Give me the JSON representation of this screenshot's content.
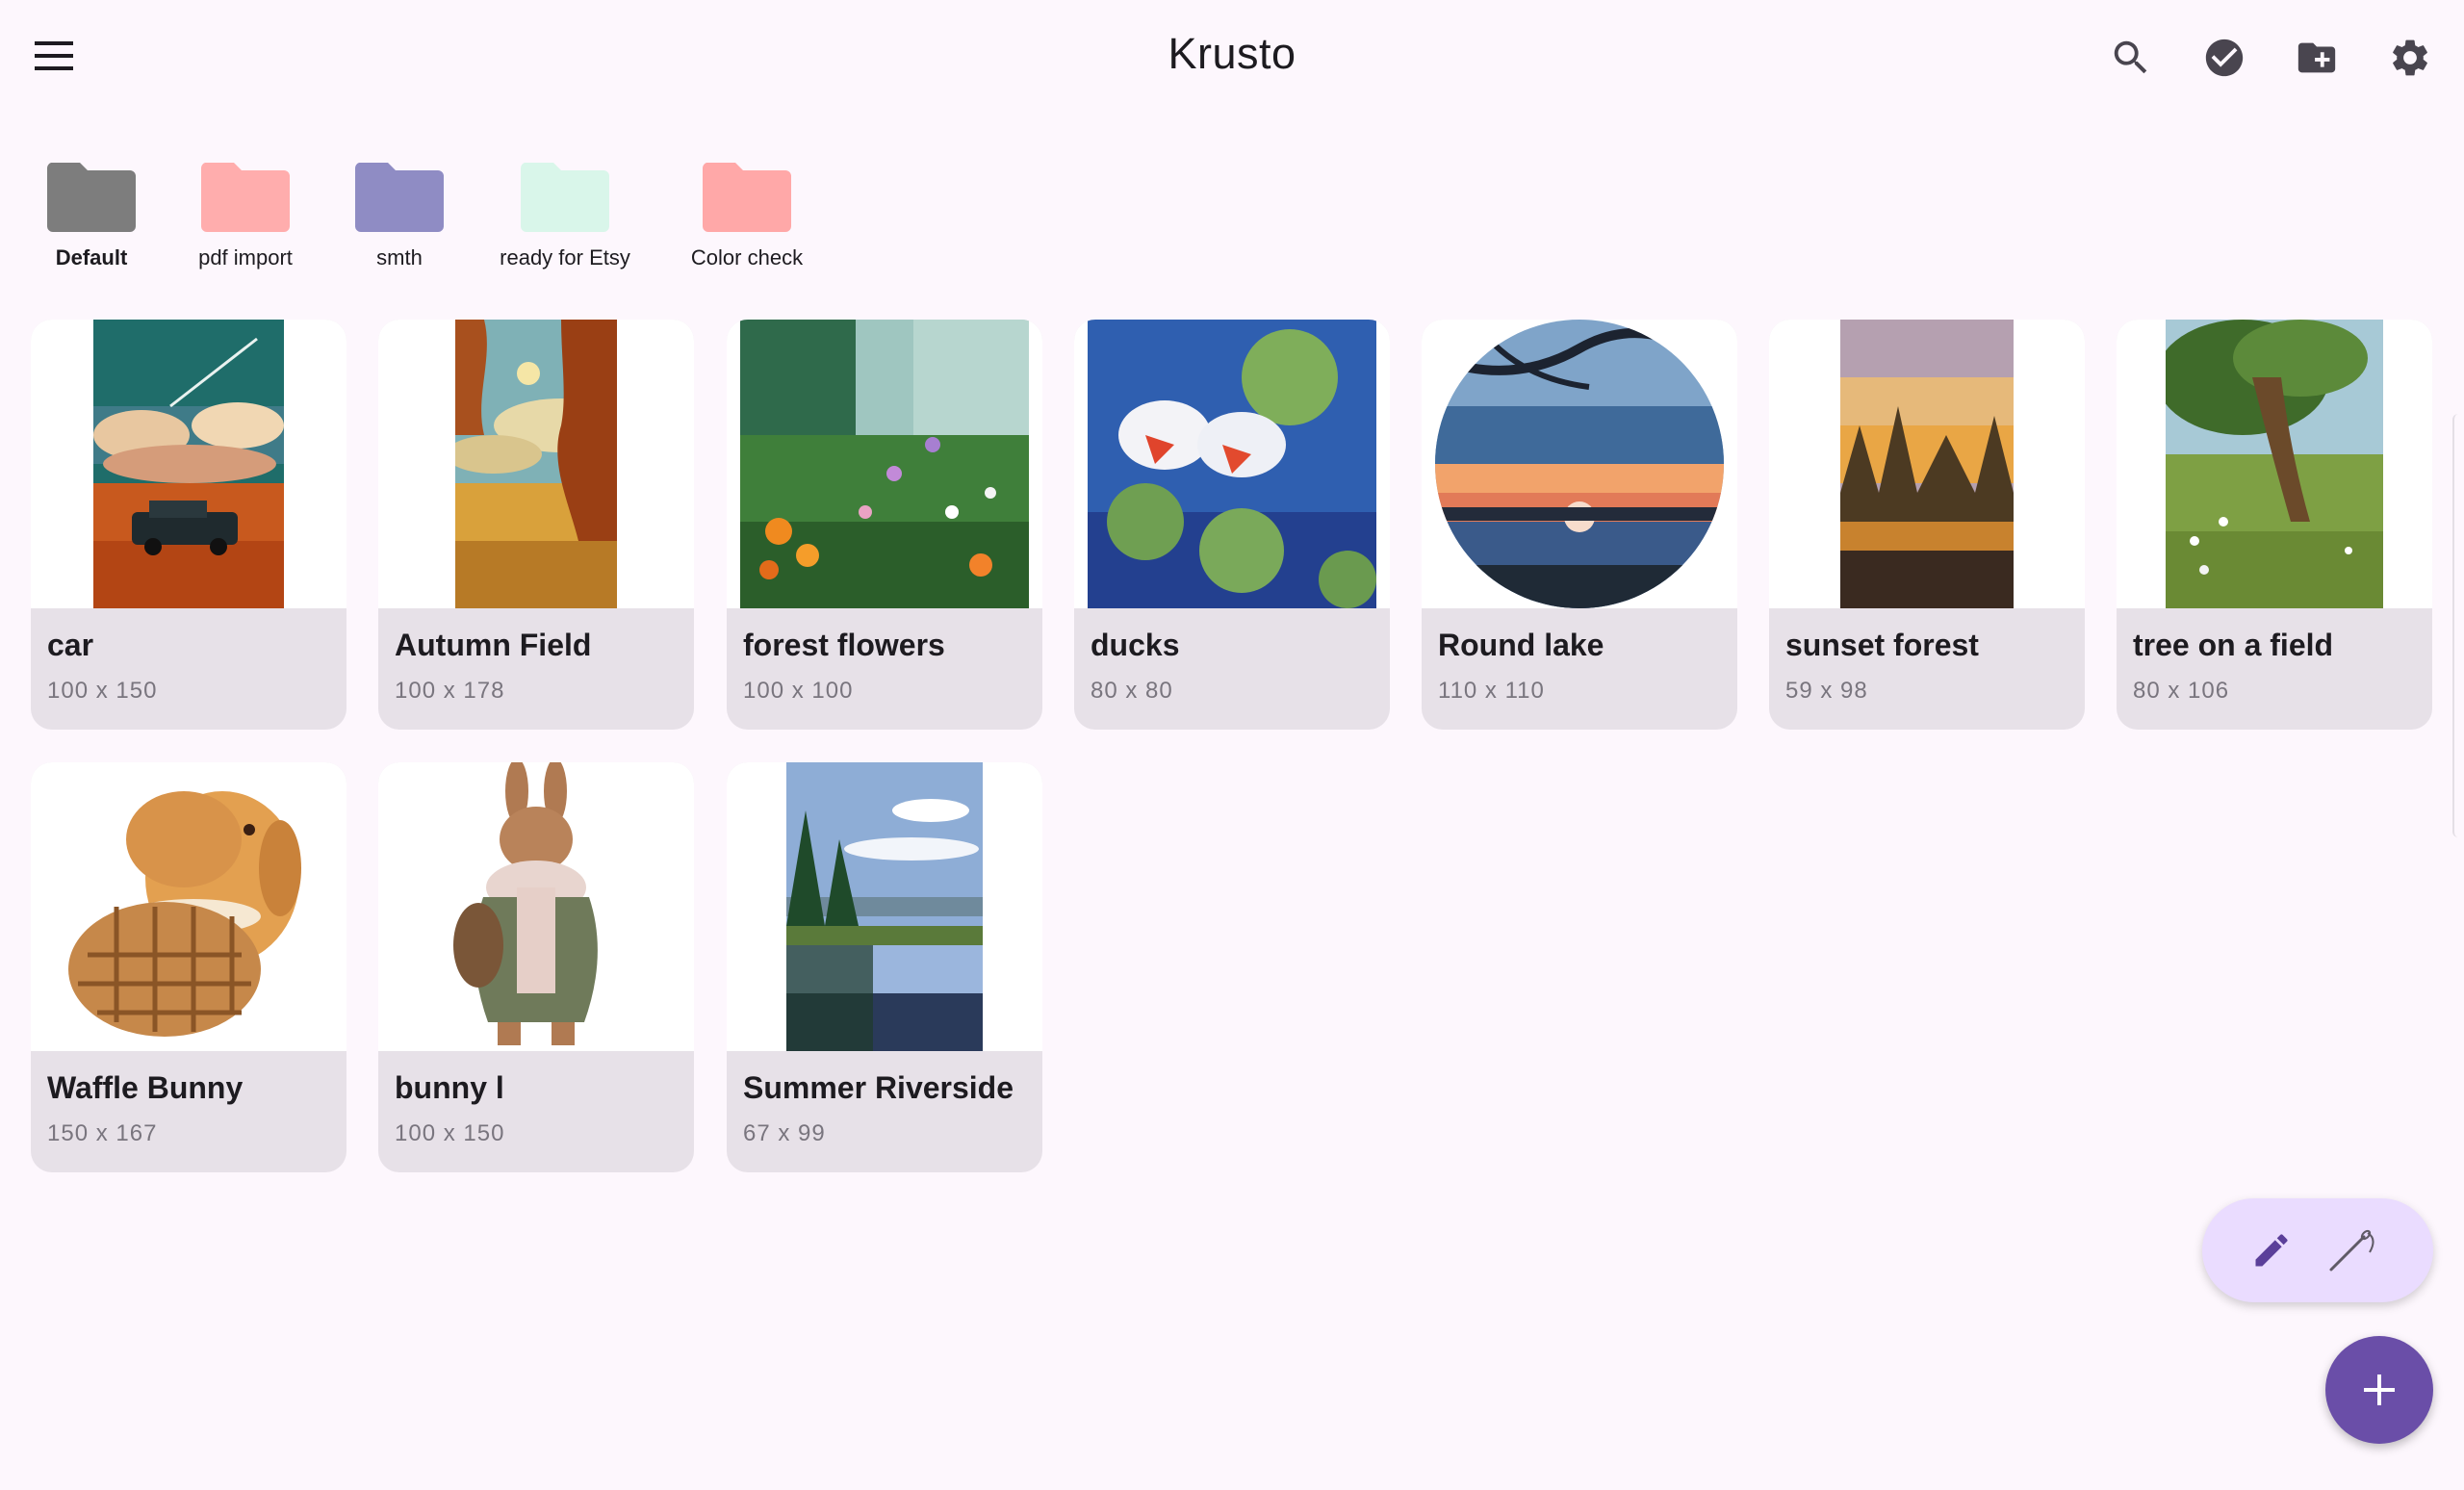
{
  "app": {
    "title": "Krusto"
  },
  "folders": [
    {
      "label": "Default",
      "color": "#7d7d7d",
      "selected": true
    },
    {
      "label": "pdf import",
      "color": "#ffadad",
      "selected": false
    },
    {
      "label": "smth",
      "color": "#8f8cc4",
      "selected": false
    },
    {
      "label": "ready for Etsy",
      "color": "#d9f6ea",
      "selected": false
    },
    {
      "label": "Color check",
      "color": "#ffa8a8",
      "selected": false
    }
  ],
  "patterns": [
    {
      "name": "car",
      "size": "100 x 150"
    },
    {
      "name": "Autumn Field",
      "size": "100 x 178"
    },
    {
      "name": "forest flowers",
      "size": "100 x 100"
    },
    {
      "name": "ducks",
      "size": "80 x 80"
    },
    {
      "name": "Round lake",
      "size": "110 x 110"
    },
    {
      "name": "sunset forest",
      "size": "59 x 98"
    },
    {
      "name": "tree on a field",
      "size": "80 x 106"
    },
    {
      "name": "Waffle Bunny",
      "size": "150 x 167"
    },
    {
      "name": "bunny l",
      "size": "100 x 150"
    },
    {
      "name": "Summer Riverside",
      "size": "67 x 99"
    }
  ],
  "icons": {
    "menu": "menu-icon",
    "search": "search-icon",
    "select": "check-circle-icon",
    "new_folder": "create-folder-icon",
    "settings": "gear-icon",
    "edit": "pencil-icon",
    "needle": "needle-icon",
    "add": "plus-icon"
  },
  "colors": {
    "background": "#fdf7fd",
    "card": "#e7e1e8",
    "accent": "#6a4ea8",
    "fab_pill": "#eadcff"
  }
}
